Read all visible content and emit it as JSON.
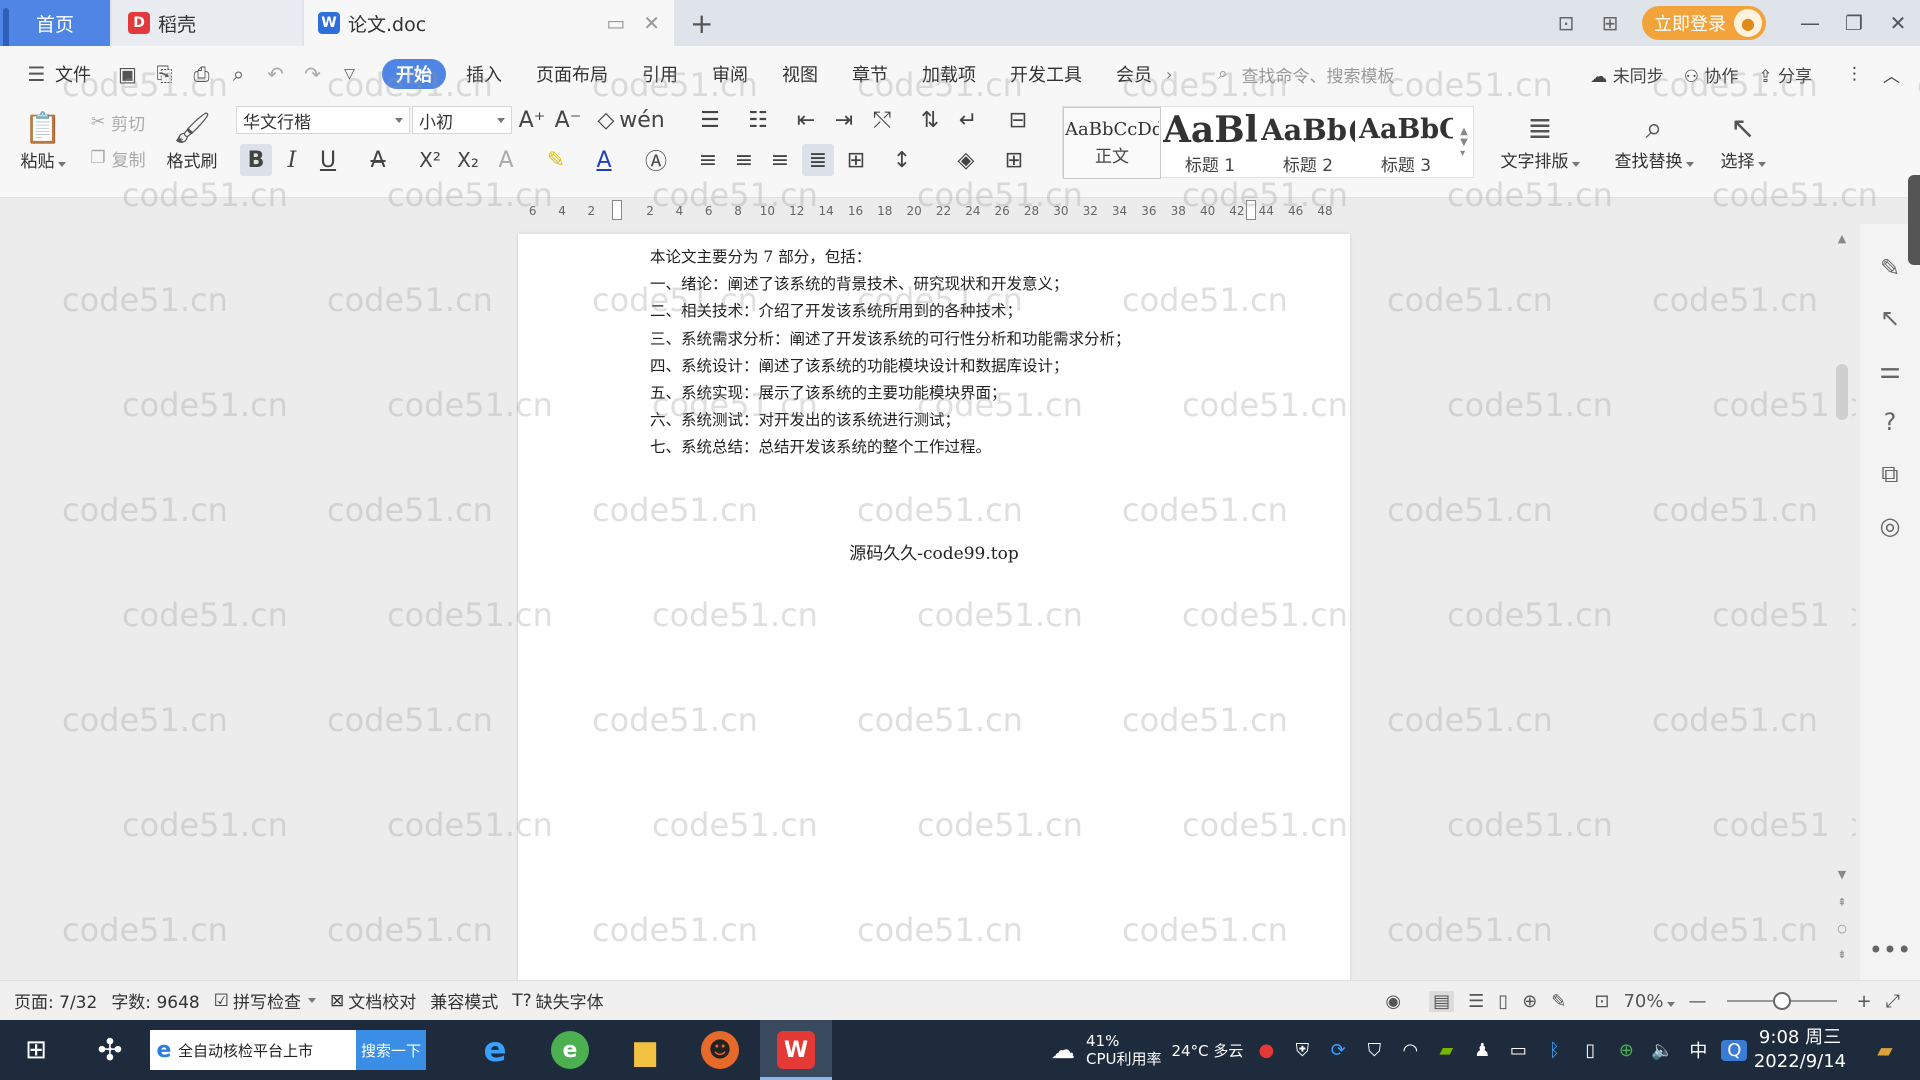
{
  "tabs": {
    "home": "首页",
    "daoke": "稻壳",
    "doc": "论文.doc",
    "new_tab": "+"
  },
  "title_right": {
    "login": "立即登录"
  },
  "menu": {
    "file": "文件",
    "tabs": [
      "开始",
      "插入",
      "页面布局",
      "引用",
      "审阅",
      "视图",
      "章节",
      "加载项",
      "开发工具",
      "会员"
    ],
    "active_tab": "开始",
    "search_cmd": "查找命令、搜索模板",
    "sync": "未同步",
    "collab": "协作",
    "share": "分享"
  },
  "ribbon": {
    "paste": "粘贴",
    "cut": "剪切",
    "copy": "复制",
    "format_painter": "格式刷",
    "font_name": "华文行楷",
    "font_size": "小初",
    "styles": [
      {
        "preview": "AaBbCcDd",
        "name": "正文"
      },
      {
        "preview": "AaBl",
        "name": "标题 1"
      },
      {
        "preview": "AaBb(",
        "name": "标题 2"
      },
      {
        "preview": "AaBbC",
        "name": "标题 3"
      }
    ],
    "text_layout": "文字排版",
    "find_replace": "查找替换",
    "select": "选择"
  },
  "ruler": {
    "ticks": [
      "6",
      "4",
      "2",
      "",
      "2",
      "4",
      "6",
      "8",
      "10",
      "12",
      "14",
      "16",
      "18",
      "20",
      "22",
      "24",
      "26",
      "28",
      "30",
      "32",
      "34",
      "36",
      "38",
      "40",
      "42",
      "44",
      "46",
      "48"
    ]
  },
  "document": {
    "lines": [
      "本论文主要分为 7 部分，包括：",
      "一、绪论：阐述了该系统的背景技术、研究现状和开发意义；",
      "二、相关技术：介绍了开发该系统所用到的各种技术；",
      "三、系统需求分析：阐述了开发该系统的可行性分析和功能需求分析；",
      "四、系统设计：阐述了该系统的功能模块设计和数据库设计；",
      "五、系统实现：展示了该系统的主要功能模块界面；",
      "六、系统测试：对开发出的该系统进行测试；",
      "七、系统总结：总结开发该系统的整个工作过程。"
    ],
    "center_text": "源码久久-code99.top",
    "watermark": "code51.cn"
  },
  "status": {
    "page": "页面: 7/32",
    "words": "字数: 9648",
    "spell": "拼写检查",
    "proof": "文档校对",
    "compat": "兼容模式",
    "missing_font": "缺失字体",
    "zoom": "70%",
    "zoom_fraction": 0.5
  },
  "taskbar": {
    "search_text": "全自动核检平台上市",
    "search_btn": "搜索一下",
    "cpu_pct": "41%",
    "cpu_label": "CPU利用率",
    "weather": "24°C 多云",
    "ime": "中",
    "time": "9:08 周三",
    "date": "2022/9/14"
  },
  "colors": {
    "accent": "#4f86e6",
    "login": "#f2a43a",
    "taskbar": "#1d2b3c"
  }
}
